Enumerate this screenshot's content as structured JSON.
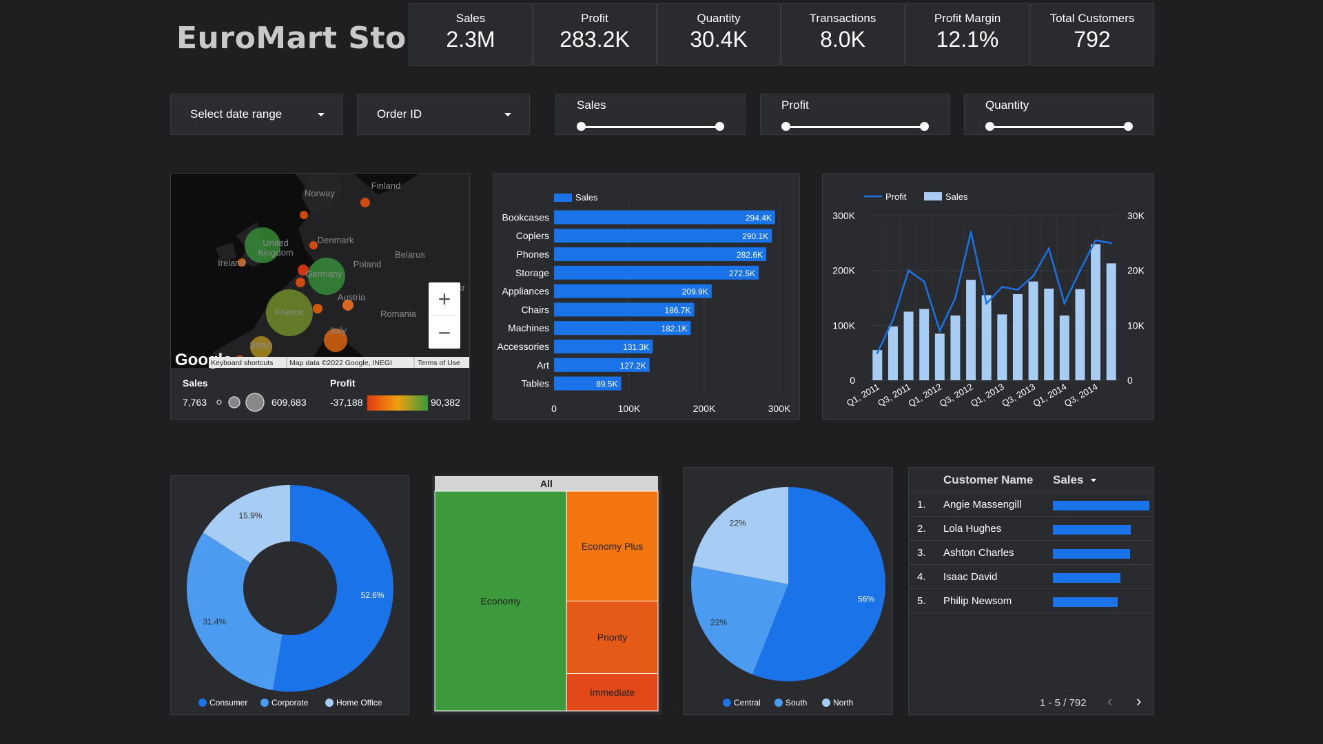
{
  "title": "EuroMart Stores",
  "kpis": [
    {
      "label": "Sales",
      "value": "2.3M"
    },
    {
      "label": "Profit",
      "value": "283.2K"
    },
    {
      "label": "Quantity",
      "value": "30.4K"
    },
    {
      "label": "Transactions",
      "value": "8.0K"
    },
    {
      "label": "Profit Margin",
      "value": "12.1%"
    },
    {
      "label": "Total Customers",
      "value": "792"
    }
  ],
  "controls": {
    "date_range": "Select date range",
    "order_id": "Order ID",
    "slider_sales": "Sales",
    "slider_profit": "Profit",
    "slider_quantity": "Quantity"
  },
  "map": {
    "countries": [
      "Finland",
      "Norway",
      "Denmark",
      "United Kingdom",
      "Ireland",
      "Belarus",
      "Poland",
      "Germany",
      "Ukr",
      "Austria",
      "France",
      "Romania",
      "Italy",
      "Spain"
    ],
    "attribution": {
      "shortcuts": "Keyboard shortcuts",
      "data": "Map data ©2022 Google, INEGI",
      "terms": "Terms of Use"
    },
    "google": "Google",
    "legend": {
      "sales_title": "Sales",
      "sales_min": "7,763",
      "sales_max": "609,683",
      "profit_title": "Profit",
      "profit_min": "-37,188",
      "profit_max": "90,382"
    },
    "zoom_in": "+",
    "zoom_out": "−"
  },
  "colors": {
    "primary": "#1a73e8",
    "mid": "#4b9bf0",
    "light": "#a8cdf5",
    "green": "#3c9a3c",
    "orange": "#f27510",
    "dark_orange": "#e65a18",
    "red_orange": "#e34818"
  },
  "chart_data": [
    {
      "type": "bar",
      "orientation": "horizontal",
      "series": [
        {
          "name": "Sales",
          "values": [
            294400,
            290100,
            282600,
            272500,
            209900,
            186700,
            182100,
            131300,
            127200,
            89500
          ]
        }
      ],
      "categories": [
        "Bookcases",
        "Copiers",
        "Phones",
        "Storage",
        "Appliances",
        "Chairs",
        "Machines",
        "Accessories",
        "Art",
        "Tables"
      ],
      "data_labels": [
        "294.4K",
        "290.1K",
        "282.6K",
        "272.5K",
        "209.9K",
        "186.7K",
        "182.1K",
        "131.3K",
        "127.2K",
        "89.5K"
      ],
      "xticks": [
        "0",
        "100K",
        "200K",
        "300K"
      ],
      "xlim": [
        0,
        300000
      ],
      "legend": "top-left"
    },
    {
      "type": "bar+line",
      "x": [
        "Q1, 2011",
        "Q2, 2011",
        "Q3, 2011",
        "Q4, 2011",
        "Q1, 2012",
        "Q2, 2012",
        "Q3, 2012",
        "Q4, 2012",
        "Q1, 2013",
        "Q2, 2013",
        "Q3, 2013",
        "Q4, 2013",
        "Q1, 2014",
        "Q2, 2014",
        "Q3, 2014",
        "Q4, 2014"
      ],
      "xticks": [
        "Q1, 2011",
        "Q3, 2011",
        "Q1, 2012",
        "Q3, 2012",
        "Q1, 2013",
        "Q3, 2013",
        "Q1, 2014",
        "Q3, 2014"
      ],
      "series": [
        {
          "name": "Sales",
          "type": "bar",
          "axis": "left",
          "values": [
            55000,
            98000,
            125000,
            130000,
            85000,
            118000,
            183000,
            155000,
            120000,
            157000,
            180000,
            167000,
            118000,
            166000,
            248000,
            213000
          ]
        },
        {
          "name": "Profit",
          "type": "line",
          "axis": "right",
          "values": [
            5000,
            11000,
            20000,
            18000,
            9000,
            15000,
            27000,
            14000,
            17000,
            16500,
            19000,
            24000,
            14000,
            20000,
            25500,
            25000
          ]
        }
      ],
      "yticks_left": [
        "0",
        "100K",
        "200K",
        "300K"
      ],
      "yticks_right": [
        "0",
        "10K",
        "20K",
        "30K"
      ],
      "ylim_left": [
        0,
        300000
      ],
      "ylim_right": [
        0,
        30000
      ],
      "legend": "top-left"
    },
    {
      "type": "pie",
      "donut": true,
      "categories": [
        "Consumer",
        "Corporate",
        "Home Office"
      ],
      "values": [
        52.6,
        31.4,
        15.9
      ],
      "labels": [
        "52.6%",
        "31.4%",
        "15.9%"
      ],
      "legend": "bottom"
    },
    {
      "type": "treemap",
      "root": "All",
      "categories": [
        "Economy",
        "Economy Plus",
        "Priority",
        "Immediate"
      ],
      "values": [
        59,
        20.5,
        13.5,
        7
      ]
    },
    {
      "type": "pie",
      "categories": [
        "Central",
        "South",
        "North"
      ],
      "values": [
        56,
        22,
        22
      ],
      "labels": [
        "56%",
        "22%",
        "22%"
      ],
      "legend": "bottom"
    },
    {
      "type": "table",
      "columns": [
        "Customer Name",
        "Sales"
      ],
      "rows": [
        {
          "rank": "1.",
          "name": "Angie Massengill",
          "sales_fraction": 1.0
        },
        {
          "rank": "2.",
          "name": "Lola Hughes",
          "sales_fraction": 0.81
        },
        {
          "rank": "3.",
          "name": "Ashton Charles",
          "sales_fraction": 0.8
        },
        {
          "rank": "4.",
          "name": "Isaac David",
          "sales_fraction": 0.7
        },
        {
          "rank": "5.",
          "name": "Philip Newsom",
          "sales_fraction": 0.67
        }
      ],
      "pagination": "1 - 5 / 792"
    }
  ]
}
